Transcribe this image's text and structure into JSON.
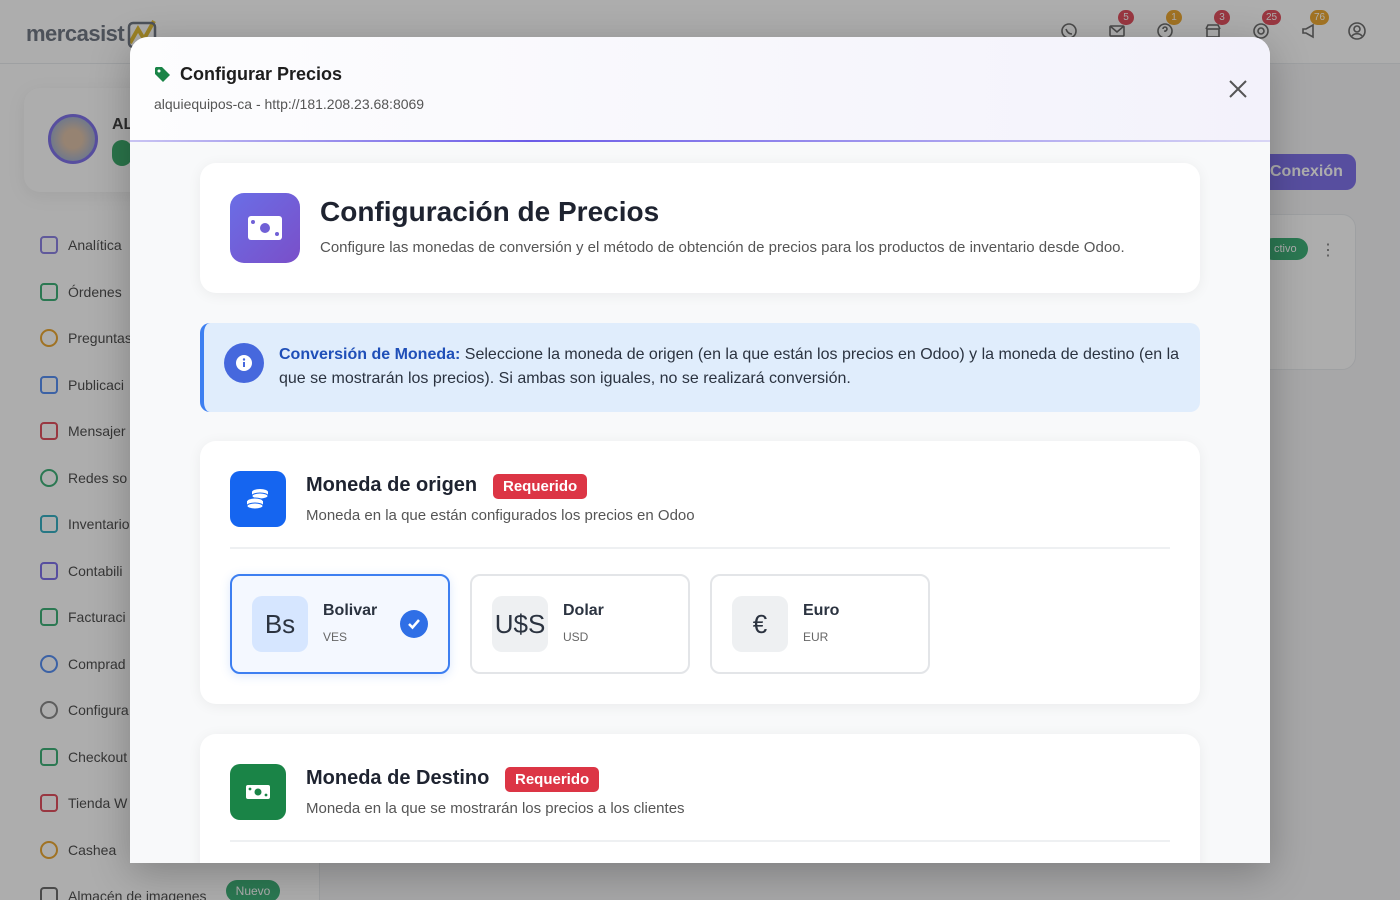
{
  "app": {
    "logo_text": "mercasist",
    "notifications": [
      {
        "icon": "whatsapp-icon",
        "count": null,
        "color": null
      },
      {
        "icon": "mail-icon",
        "count": "5",
        "color": "#dc3545"
      },
      {
        "icon": "question-icon",
        "count": "1",
        "color": "#e89a12"
      },
      {
        "icon": "store-icon",
        "count": "3",
        "color": "#dc3545"
      },
      {
        "icon": "settings-icon",
        "count": "25",
        "color": "#dc3545"
      },
      {
        "icon": "megaphone-icon",
        "count": "76",
        "color": "#e89a12"
      },
      {
        "icon": "user-circle-icon",
        "count": null,
        "color": null
      }
    ],
    "user_initials": "AL",
    "nav": [
      "Analítica",
      "Órdenes",
      "Preguntas",
      "Publicaci",
      "Mensajer",
      "Redes so",
      "Inventario",
      "Contabili",
      "Facturaci",
      "Comprad",
      "Configura",
      "Checkout",
      "Tienda W",
      "Cashea",
      "Almacén de imagenes"
    ],
    "nav_badge": "Nuevo",
    "conexion_button": "Conexión",
    "status_pill": "ctivo"
  },
  "modal": {
    "title": "Configurar Precios",
    "subtitle": "alquiequipos-ca - http://181.208.23.68:8069",
    "hero": {
      "title": "Configuración de Precios",
      "description": "Configure las monedas de conversión y el método de obtención de precios para los productos de inventario desde Odoo."
    },
    "info": {
      "label": "Conversión de Moneda:",
      "text": " Seleccione la moneda de origen (en la que están los precios en Odoo) y la moneda de destino (en la que se mostrarán los precios). Si ambas son iguales, no se realizará conversión."
    },
    "origin": {
      "title": "Moneda de origen",
      "badge": "Requerido",
      "description": "Moneda en la que están configurados los precios en Odoo",
      "selected": "VES",
      "options": [
        {
          "symbol": "Bs",
          "name": "Bolivar",
          "code": "VES"
        },
        {
          "symbol": "U$S",
          "name": "Dolar",
          "code": "USD"
        },
        {
          "symbol": "€",
          "name": "Euro",
          "code": "EUR"
        }
      ]
    },
    "destination": {
      "title": "Moneda de Destino",
      "badge": "Requerido",
      "description": "Moneda en la que se mostrarán los precios a los clientes"
    }
  },
  "colors": {
    "accent": "#6c5ce7",
    "selected_border": "#3d7ff1",
    "required": "#dc3545",
    "origin_icon_bg": "#1565f0",
    "destination_icon_bg": "#1a8447",
    "title_icon": "#1a8447"
  }
}
